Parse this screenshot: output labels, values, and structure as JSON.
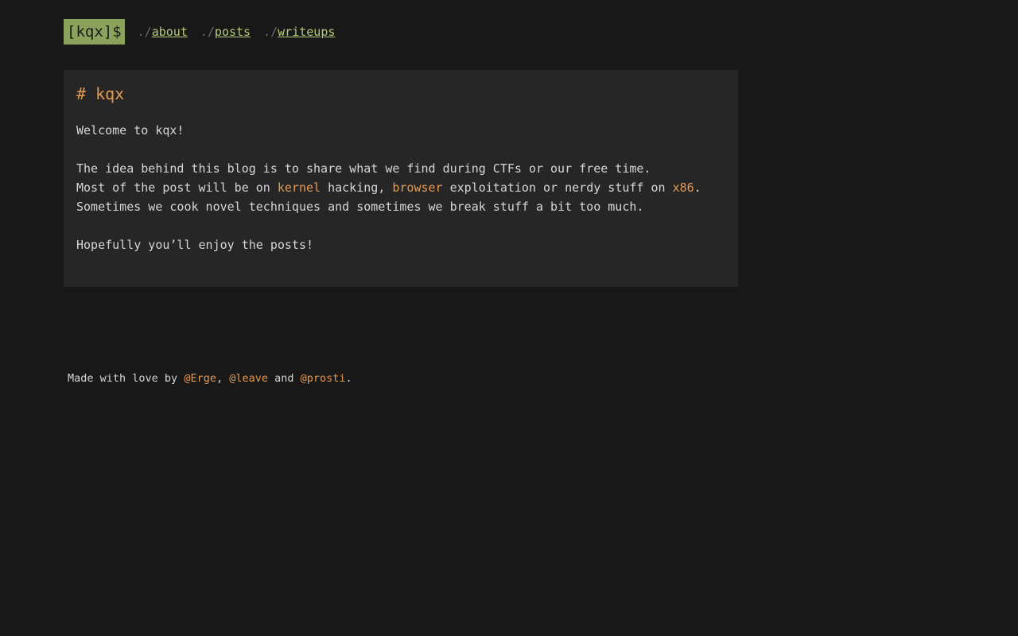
{
  "header": {
    "logo": "[kqx]$",
    "nav": [
      {
        "prefix": "./",
        "label": "about"
      },
      {
        "prefix": "./",
        "label": "posts"
      },
      {
        "prefix": "./",
        "label": "writeups"
      }
    ]
  },
  "main": {
    "title": "# kqx",
    "welcome": "Welcome to kqx!",
    "line1": "The idea behind this blog is to share what we find during CTFs or our free time.",
    "line2_a": "Most of the post will be on ",
    "line2_kernel": "kernel",
    "line2_b": " hacking, ",
    "line2_browser": "browser",
    "line2_c": " exploitation or nerdy stuff on ",
    "line2_x86": "x86",
    "line2_d": ".",
    "line3": "Sometimes we cook novel techniques and sometimes we break stuff a bit too much.",
    "closing": "Hopefully you’ll enjoy the posts!"
  },
  "footer": {
    "prefix": "Made with love by ",
    "author1": "@Erge",
    "sep1": ", ",
    "author2": "@leave",
    "sep2": " and ",
    "author3": "@prosti",
    "suffix": "."
  },
  "colors": {
    "background": "#181818",
    "panel": "#262626",
    "accent": "#e49a52",
    "logo_bg": "#8aa25c",
    "link": "#b5c97a"
  }
}
